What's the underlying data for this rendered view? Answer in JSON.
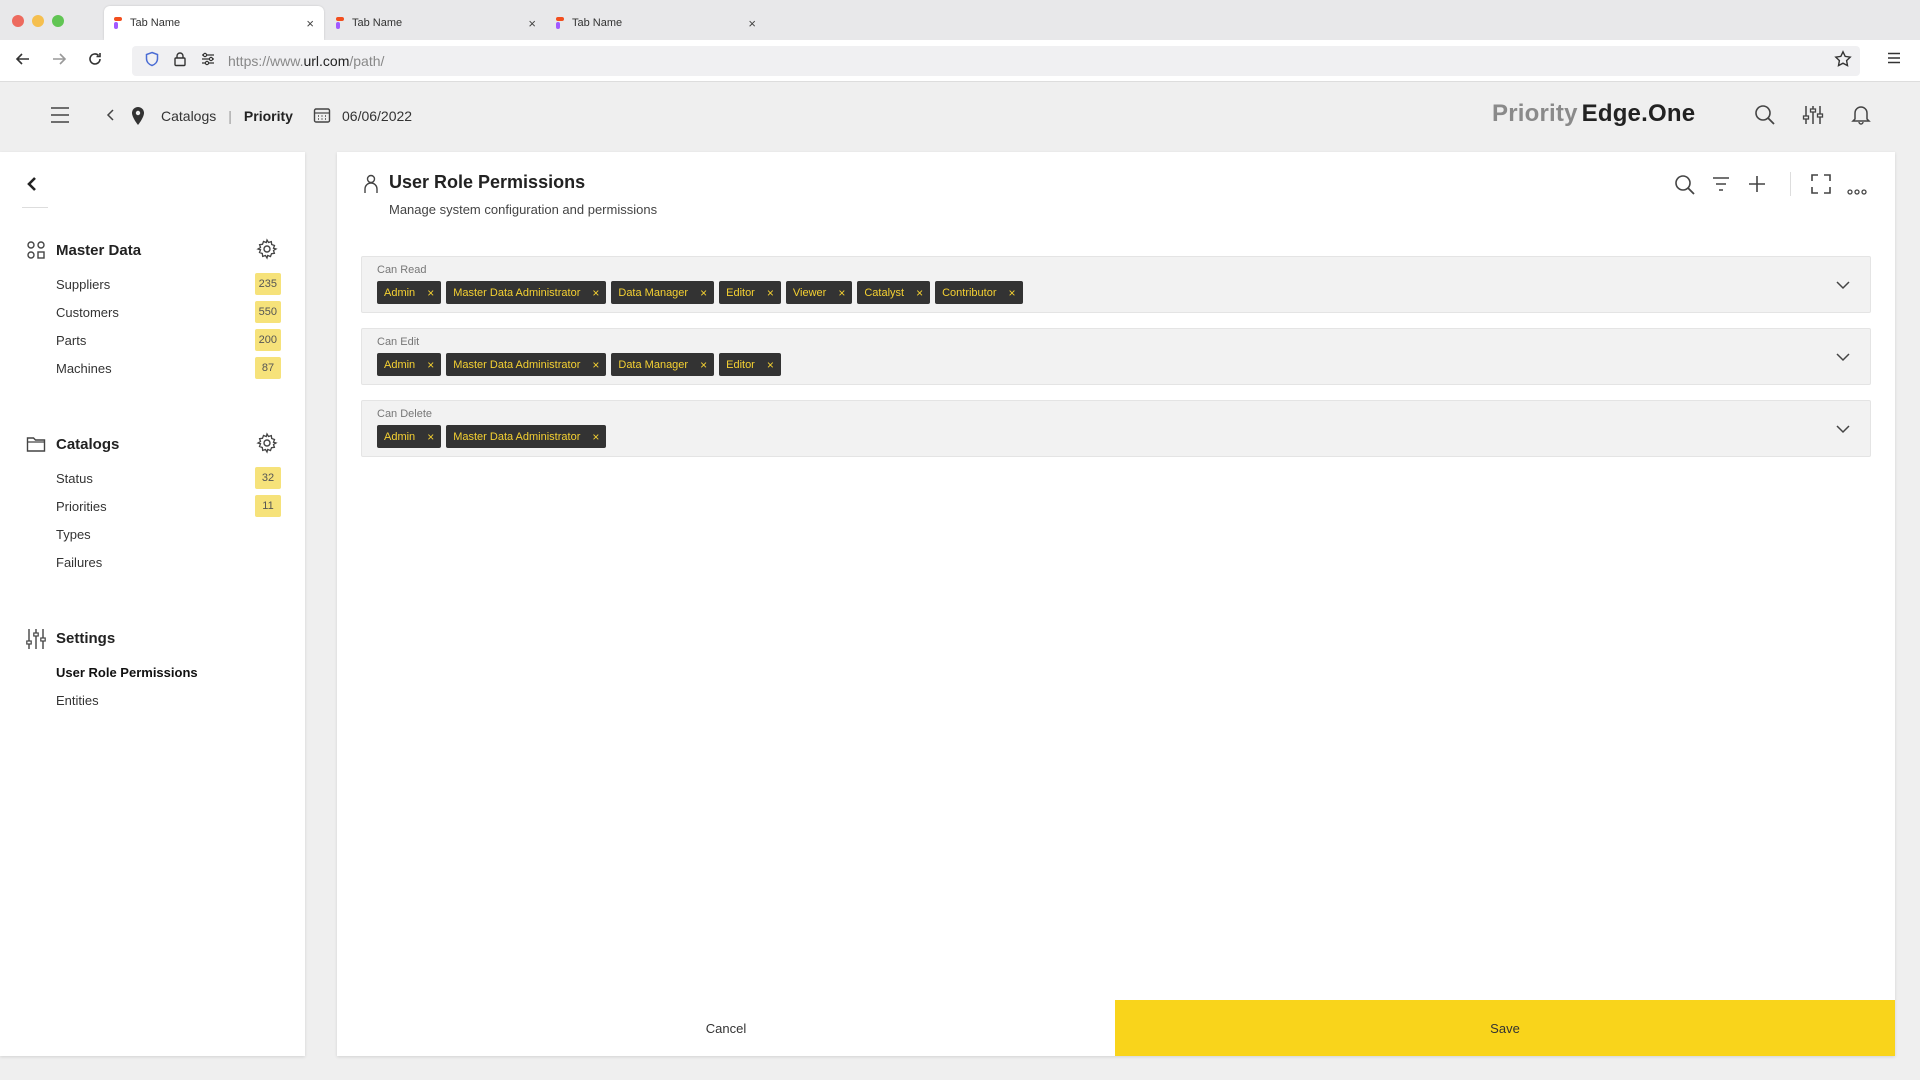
{
  "browser": {
    "tabs": [
      {
        "label": "Tab Name",
        "close": "×"
      },
      {
        "label": "Tab Name",
        "close": "×"
      },
      {
        "label": "Tab Name",
        "close": "×"
      }
    ],
    "url_prefix": "https://www.",
    "url_domain": "url.com",
    "url_path": "/path/"
  },
  "header": {
    "breadcrumb_parent": "Catalogs",
    "breadcrumb_separator": "|",
    "breadcrumb_current": "Priority",
    "date": "06/06/2022",
    "logo_part1": "Priority",
    "logo_part2": "Edge.One"
  },
  "sidebar": {
    "back_icon": "chevron-left-icon",
    "sections": [
      {
        "title": "Master Data",
        "icon": "grid-nodes-icon",
        "items": [
          {
            "label": "Suppliers",
            "count": "235"
          },
          {
            "label": "Customers",
            "count": "550"
          },
          {
            "label": "Parts",
            "count": "200"
          },
          {
            "label": "Machines",
            "count": "87"
          }
        ]
      },
      {
        "title": "Catalogs",
        "icon": "folder-icon",
        "items": [
          {
            "label": "Status",
            "count": "32"
          },
          {
            "label": "Priorities",
            "count": "11"
          },
          {
            "label": "Types",
            "count": ""
          },
          {
            "label": "Failures",
            "count": ""
          }
        ]
      },
      {
        "title": "Settings",
        "icon": "sliders-icon",
        "items": [
          {
            "label": "User Role Permissions",
            "count": ""
          },
          {
            "label": "Entities",
            "count": ""
          }
        ]
      }
    ]
  },
  "main": {
    "title": "User Role Permissions",
    "subtitle": "Manage system configuration and permissions",
    "permissions": [
      {
        "label": "Can Read",
        "roles": [
          "Admin",
          "Master Data Administrator",
          "Data Manager",
          "Editor",
          "Viewer",
          "Catalyst",
          "Contributor"
        ]
      },
      {
        "label": "Can Edit",
        "roles": [
          "Admin",
          "Master Data Administrator",
          "Data Manager",
          "Editor"
        ]
      },
      {
        "label": "Can Delete",
        "roles": [
          "Admin",
          "Master Data Administrator"
        ]
      }
    ],
    "chip_remove": "×",
    "cancel_label": "Cancel",
    "save_label": "Save"
  },
  "colors": {
    "accent": "#f9d41b",
    "chip_bg": "#333333",
    "chip_text": "#f5d132",
    "badge_bg": "#f6e27a"
  }
}
